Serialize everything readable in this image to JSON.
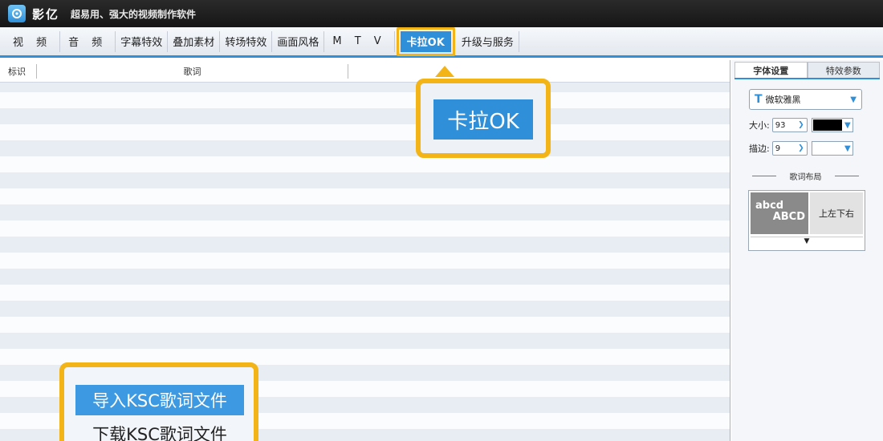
{
  "titlebar": {
    "app_name": "影亿",
    "slogan": "超易用、强大的视频制作软件",
    "logo_icon": "app-logo-icon"
  },
  "menu": {
    "items": [
      "视 频",
      "音 频",
      "字幕特效",
      "叠加素材",
      "转场特效",
      "画面风格",
      "M T V",
      "卡拉OK",
      "升级与服务"
    ],
    "active": "卡拉OK"
  },
  "list": {
    "col_mark": "标识",
    "col_lyric": "歌词"
  },
  "side": {
    "tabs": [
      "字体设置",
      "特效参数"
    ],
    "font_name": "微软雅黑",
    "size_label": "大小:",
    "size_value": "93",
    "stroke_label": "描边:",
    "stroke_value": "9",
    "color": "#000000",
    "layout_title": "歌词布局",
    "layout_opt1_line1": "abcd",
    "layout_opt1_line2": "ABCD",
    "layout_opt2": "上左下右",
    "layout_more": "▼"
  },
  "callouts": {
    "karaoke": "卡拉OK",
    "import_ksc": "导入KSC歌词文件",
    "download_ksc": "下载KSC歌词文件"
  },
  "colors": {
    "accent": "#2f8fd8",
    "highlight": "#f3b417"
  }
}
